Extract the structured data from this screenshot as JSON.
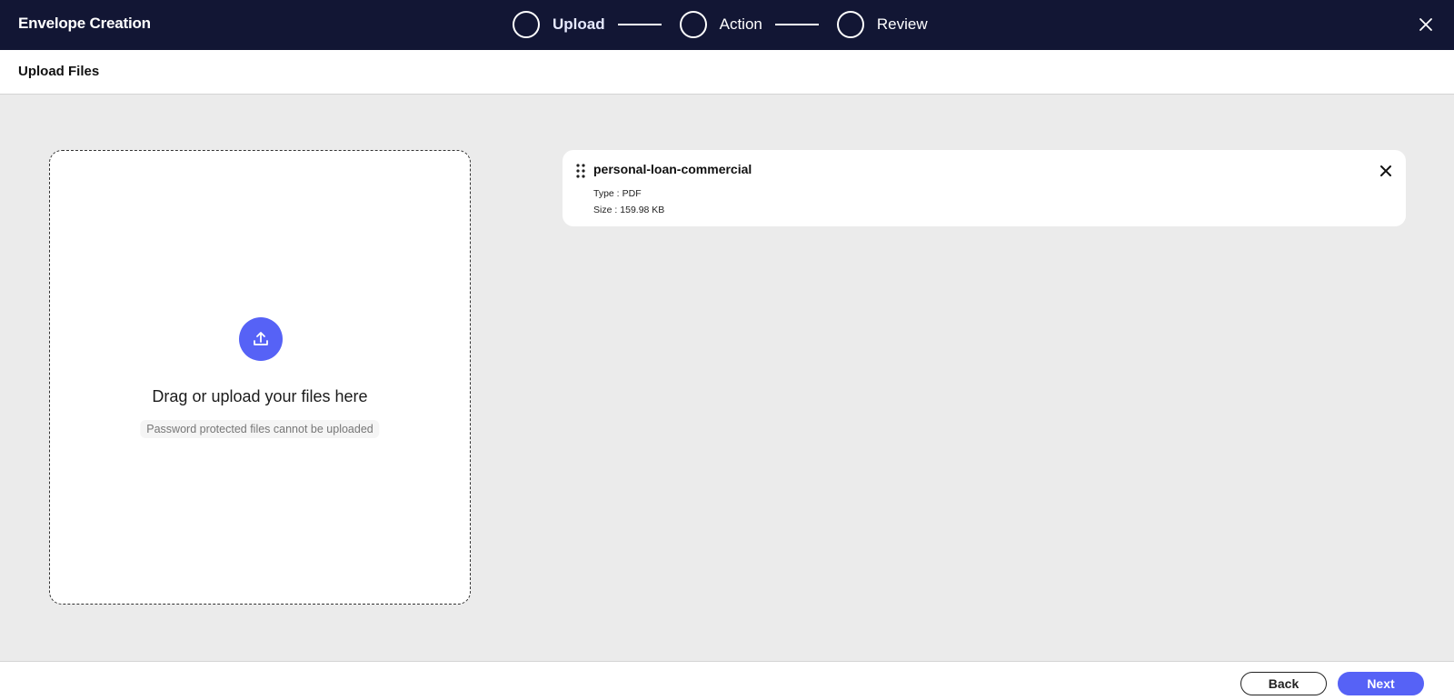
{
  "header": {
    "title": "Envelope Creation",
    "steps": [
      {
        "label": "Upload",
        "active": true
      },
      {
        "label": "Action",
        "active": false
      },
      {
        "label": "Review",
        "active": false
      }
    ],
    "close_icon": "close-icon"
  },
  "subheader": {
    "title": "Upload Files"
  },
  "dropzone": {
    "icon": "upload-icon",
    "title": "Drag or upload your files here",
    "note": "Password protected files cannot be uploaded"
  },
  "files": [
    {
      "name": "personal-loan-commercial",
      "type_label": "Type :",
      "type": "PDF",
      "size_label": "Size :",
      "size": "159.98 KB"
    }
  ],
  "footer": {
    "back_label": "Back",
    "next_label": "Next"
  },
  "colors": {
    "header_bg": "#121634",
    "accent": "#5662f6",
    "page_bg": "#ebebeb"
  }
}
